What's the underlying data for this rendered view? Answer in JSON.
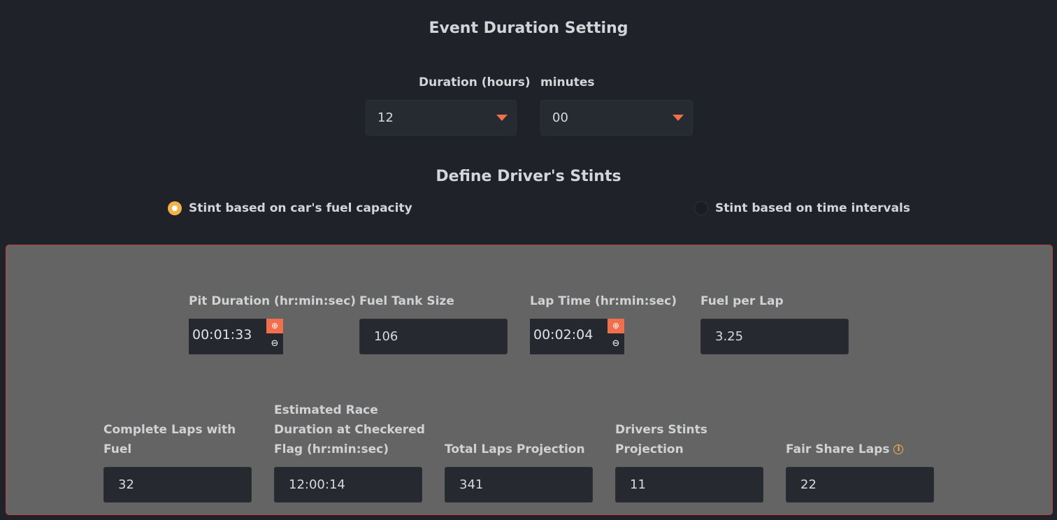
{
  "event": {
    "title": "Event Duration Setting",
    "duration_hours_label": "Duration (hours)",
    "duration_hours_value": "12",
    "minutes_label": "minutes",
    "minutes_value": "00"
  },
  "stints": {
    "title": "Define Driver's Stints",
    "option_fuel": "Stint based on car's fuel capacity",
    "option_time": "Stint based on time intervals",
    "selected": "fuel"
  },
  "inputs": {
    "pit_duration_label": "Pit Duration (hr:min:sec)",
    "pit_duration_value": "00:01:33",
    "fuel_tank_label": "Fuel Tank Size",
    "fuel_tank_value": "106",
    "lap_time_label": "Lap Time (hr:min:sec)",
    "lap_time_value": "00:02:04",
    "fuel_per_lap_label": "Fuel per Lap",
    "fuel_per_lap_value": "3.25"
  },
  "outputs": {
    "complete_laps_label_1": "Complete Laps with",
    "complete_laps_label_2": "Fuel",
    "complete_laps_value": "32",
    "est_duration_label_1": "Estimated Race",
    "est_duration_label_2": "Duration at Checkered",
    "est_duration_label_3": "Flag (hr:min:sec)",
    "est_duration_value": "12:00:14",
    "total_laps_label": "Total Laps Projection",
    "total_laps_value": "341",
    "driver_stints_label_1": "Drivers Stints",
    "driver_stints_label_2": "Projection",
    "driver_stints_value": "11",
    "fair_share_label": "Fair Share Laps",
    "fair_share_value": "22"
  },
  "icons": {
    "caret": "caret-down-icon",
    "increment": "plus-circle-icon",
    "decrement": "minus-circle-icon",
    "info": "info-circle-icon"
  },
  "colors": {
    "accent_orange": "#f26f4e",
    "radio_selected": "#f2b34a",
    "panel_border": "#c0413a",
    "panel_bg": "#646464",
    "page_bg": "#1f2228"
  }
}
